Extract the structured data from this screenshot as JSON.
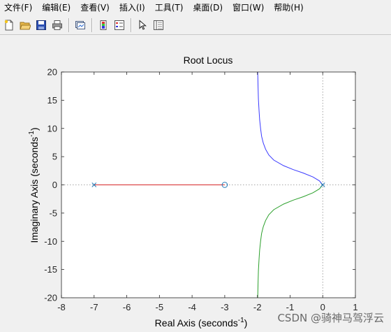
{
  "menu": [
    {
      "label": "文件(F)"
    },
    {
      "label": "编辑(E)"
    },
    {
      "label": "查看(V)"
    },
    {
      "label": "插入(I)"
    },
    {
      "label": "工具(T)"
    },
    {
      "label": "桌面(D)"
    },
    {
      "label": "窗口(W)"
    },
    {
      "label": "帮助(H)"
    }
  ],
  "toolbar": {
    "icons": [
      "new-file-icon",
      "open-file-icon",
      "save-icon",
      "print-icon",
      "link-plot-icon",
      "insert-colorbar-icon",
      "insert-legend-icon",
      "edit-plot-arrow-icon",
      "property-inspector-icon"
    ]
  },
  "watermark": "CSDN @骑神马驾浮云",
  "colors": {
    "window_bg": "#f0f0f0",
    "upper_branch": "#3a3aff",
    "lower_branch": "#2ca02c",
    "real_branch": "#d62728",
    "poles_zeros": "#1f77b4"
  },
  "chart_data": {
    "type": "line",
    "title": "Root Locus",
    "xlabel_main": "Real Axis (seconds",
    "xlabel_sup": "-1",
    "xlabel_close": ")",
    "ylabel_main": "Imaginary Axis (seconds",
    "ylabel_sup": "-1",
    "ylabel_close": ")",
    "xlim": [
      -8,
      1
    ],
    "ylim": [
      -20,
      20
    ],
    "xticks": [
      -8,
      -7,
      -6,
      -5,
      -4,
      -3,
      -2,
      -1,
      0,
      1
    ],
    "yticks": [
      -20,
      -15,
      -10,
      -5,
      0,
      5,
      10,
      15,
      20
    ],
    "xtick_labels": [
      "-8",
      "-7",
      "-6",
      "-5",
      "-4",
      "-3",
      "-2",
      "-1",
      "0",
      "1"
    ],
    "ytick_labels": [
      "-20",
      "-15",
      "-10",
      "-5",
      "0",
      "5",
      "10",
      "15",
      "20"
    ],
    "poles": [
      {
        "x": -7,
        "y": 0
      },
      {
        "x": 0,
        "y": 0
      }
    ],
    "zeros": [
      {
        "x": -3,
        "y": 0
      }
    ],
    "series": [
      {
        "id": "real",
        "color": "#d62728",
        "x": [
          -7,
          -3
        ],
        "y": [
          0,
          0
        ]
      },
      {
        "id": "upper",
        "color": "#3a3aff",
        "x": [
          0,
          -0.1,
          -0.3,
          -0.6,
          -0.9,
          -1.2,
          -1.5,
          -1.65,
          -1.75,
          -1.82,
          -1.87,
          -1.9,
          -1.93,
          -1.95,
          -1.97,
          -1.98,
          -1.99
        ],
        "y": [
          0,
          0.7,
          1.4,
          2.1,
          2.7,
          3.4,
          4.4,
          5.3,
          6.3,
          7.4,
          8.6,
          9.9,
          11.5,
          13.2,
          15.2,
          17.4,
          20
        ]
      },
      {
        "id": "lower",
        "color": "#2ca02c",
        "x": [
          0,
          -0.1,
          -0.3,
          -0.6,
          -0.9,
          -1.2,
          -1.5,
          -1.65,
          -1.75,
          -1.82,
          -1.87,
          -1.9,
          -1.93,
          -1.95,
          -1.97,
          -1.98,
          -1.99
        ],
        "y": [
          0,
          -0.7,
          -1.4,
          -2.1,
          -2.7,
          -3.4,
          -4.4,
          -5.3,
          -6.3,
          -7.4,
          -8.6,
          -9.9,
          -11.5,
          -13.2,
          -15.2,
          -17.4,
          -20
        ]
      }
    ],
    "grid": false,
    "zero_lines": true
  }
}
